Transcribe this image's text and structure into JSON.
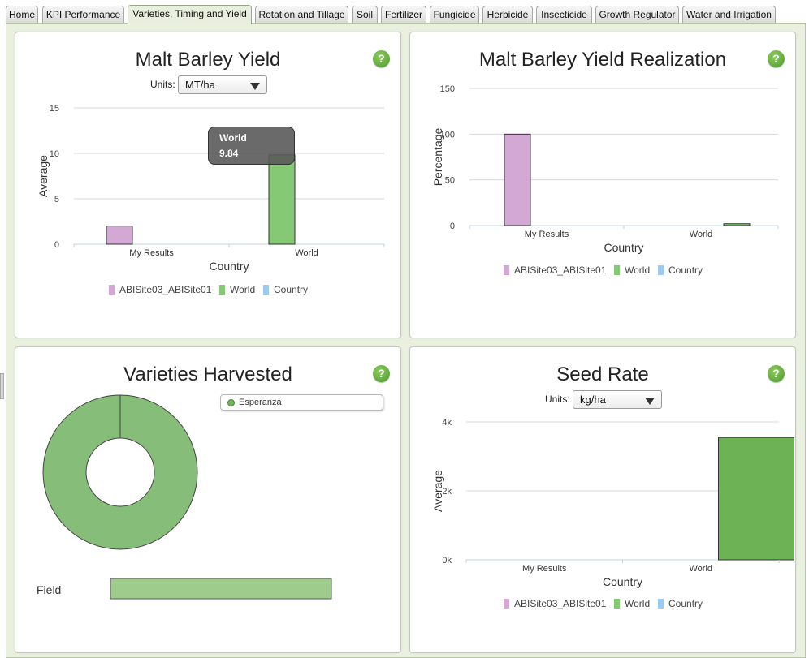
{
  "tabs": [
    {
      "label": "Home",
      "active": false
    },
    {
      "label": "KPI Performance",
      "active": false
    },
    {
      "label": "Varieties, Timing and Yield",
      "active": true
    },
    {
      "label": "Rotation and Tillage",
      "active": false
    },
    {
      "label": "Soil",
      "active": false
    },
    {
      "label": "Fertilizer",
      "active": false
    },
    {
      "label": "Fungicide",
      "active": false
    },
    {
      "label": "Herbicide",
      "active": false
    },
    {
      "label": "Insecticide",
      "active": false
    },
    {
      "label": "Growth Regulator",
      "active": false
    },
    {
      "label": "Water and Irrigation",
      "active": false
    }
  ],
  "help_glyph": "?",
  "units_label": "Units:",
  "colors": {
    "my_results": "#d4a8d4",
    "world": "#6db356",
    "country": "#9ccaf0",
    "world_light": "#85c974",
    "donut": "#86bd78",
    "field_bar": "#9ecc8c"
  },
  "panels": {
    "yield": {
      "title": "Malt Barley Yield",
      "units_value": "MT/ha",
      "tooltip": {
        "series": "World",
        "value": "9.84"
      }
    },
    "realization": {
      "title": "Malt Barley Yield Realization"
    },
    "varieties": {
      "title": "Varieties Harvested",
      "legend_item": "Esperanza",
      "field_label": "Field"
    },
    "seed": {
      "title": "Seed Rate",
      "units_value": "kg/ha"
    }
  },
  "chart_data": [
    {
      "type": "bar",
      "title": "Malt Barley Yield",
      "categories": [
        "My Results",
        "World"
      ],
      "series": [
        {
          "name": "ABISite03_ABISite01",
          "values": [
            2,
            null
          ]
        },
        {
          "name": "World",
          "values": [
            null,
            9.84
          ]
        },
        {
          "name": "Country",
          "values": [
            null,
            null
          ]
        }
      ],
      "xlabel": "Country",
      "ylabel": "Average",
      "ylim": [
        0,
        15
      ],
      "yticks": [
        "0",
        "5",
        "10",
        "15"
      ],
      "grid": true,
      "legend": "bottom"
    },
    {
      "type": "bar",
      "title": "Malt Barley Yield Realization",
      "categories": [
        "My Results",
        "World"
      ],
      "series": [
        {
          "name": "ABISite03_ABISite01",
          "values": [
            100,
            null
          ]
        },
        {
          "name": "World",
          "values": [
            null,
            2
          ]
        },
        {
          "name": "Country",
          "values": [
            null,
            null
          ]
        }
      ],
      "xlabel": "Country",
      "ylabel": "Percentage",
      "ylim": [
        0,
        150
      ],
      "yticks": [
        "0",
        "50",
        "100",
        "150"
      ],
      "grid": true,
      "legend": "bottom"
    },
    {
      "type": "pie",
      "title": "Varieties Harvested",
      "labels": [
        "Esperanza"
      ],
      "values": [
        100
      ],
      "donut": true,
      "legend": "top-right"
    },
    {
      "type": "bar",
      "title": "Varieties Harvested",
      "orientation": "horizontal",
      "categories": [
        "Field"
      ],
      "values": [
        1
      ]
    },
    {
      "type": "bar",
      "title": "Seed Rate",
      "categories": [
        "My Results",
        "World"
      ],
      "series": [
        {
          "name": "ABISite03_ABISite01",
          "values": [
            null,
            null
          ]
        },
        {
          "name": "World",
          "values": [
            null,
            3550
          ]
        },
        {
          "name": "Country",
          "values": [
            null,
            null
          ]
        }
      ],
      "xlabel": "Country",
      "ylabel": "Average",
      "ylim": [
        0,
        4000
      ],
      "yticks": [
        "0k",
        "2k",
        "4k"
      ],
      "grid": true,
      "legend": "bottom"
    }
  ]
}
